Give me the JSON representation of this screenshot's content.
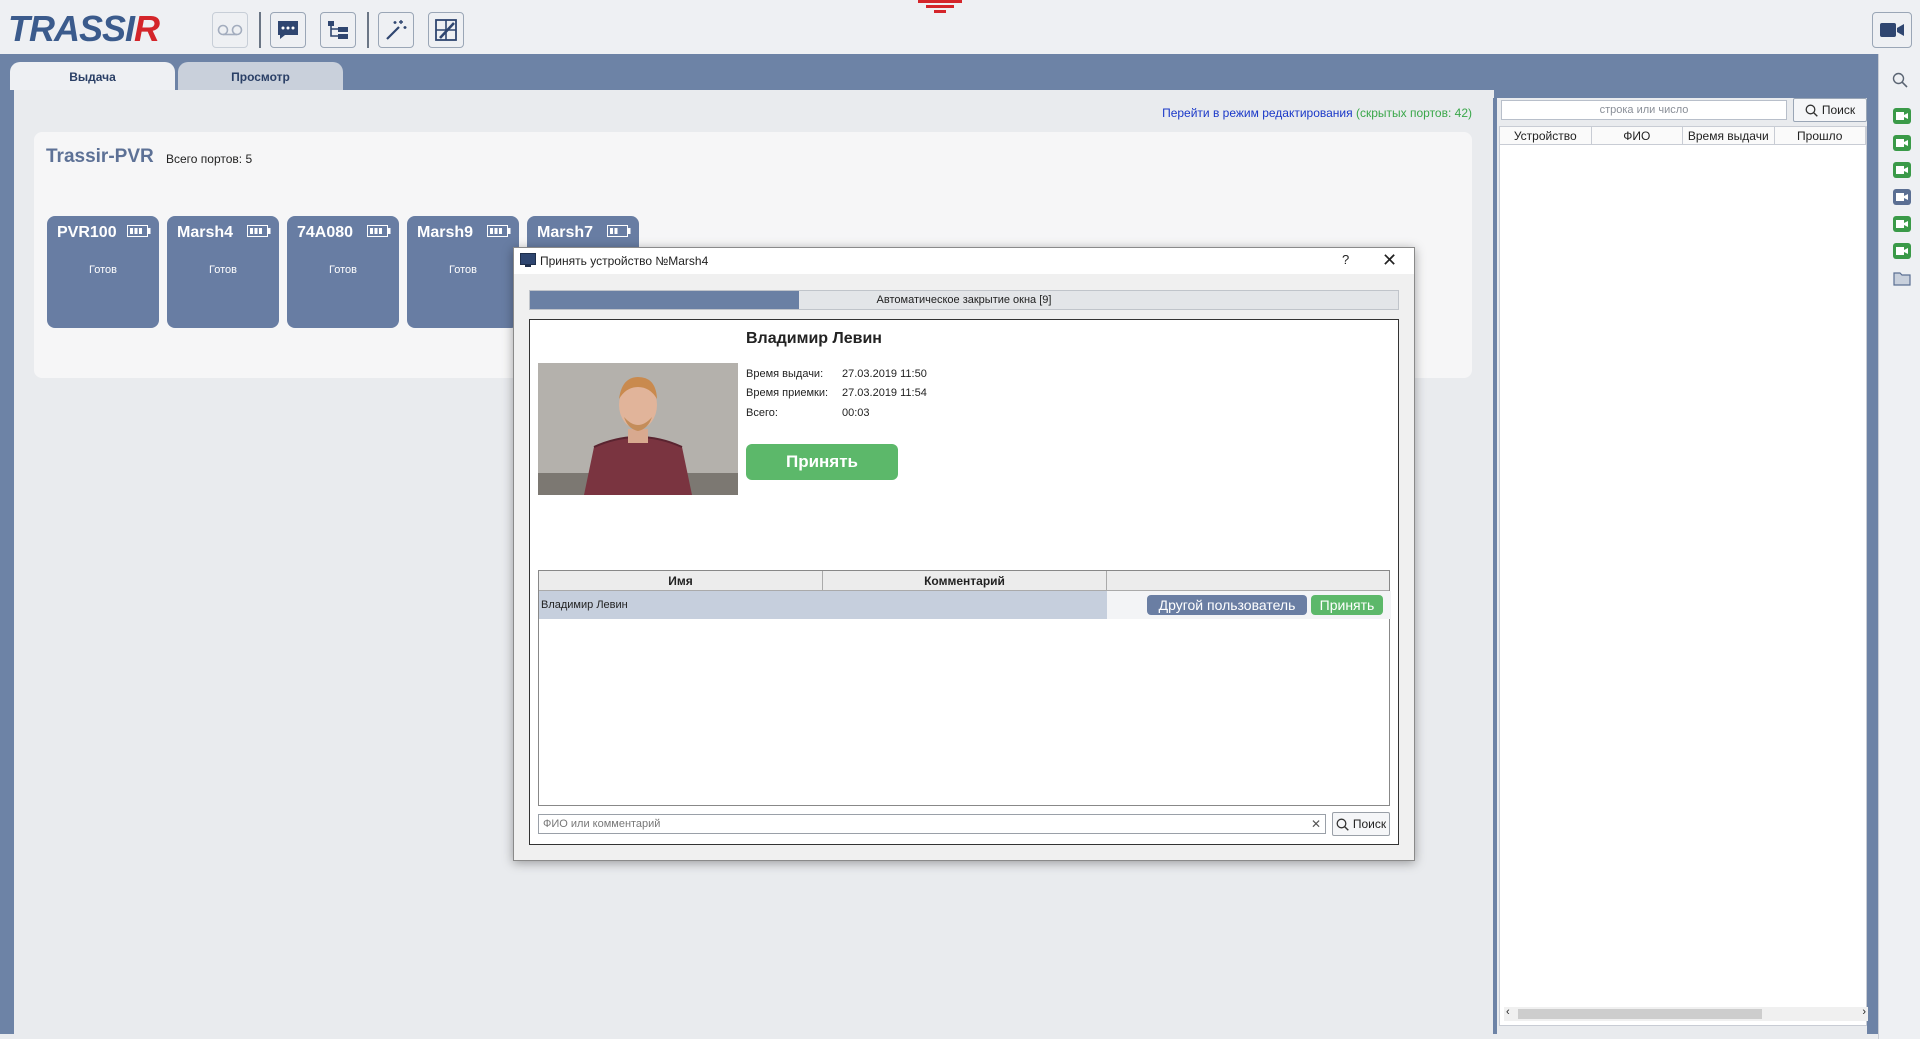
{
  "app": {
    "logo_text": "TRASSIR"
  },
  "tabs": [
    {
      "label": "Выдача"
    },
    {
      "label": "Просмотр"
    }
  ],
  "edit_mode": {
    "link_text": "Перейти в режим редактирования",
    "hidden_ports": "(скрытых портов: 42)"
  },
  "pvr": {
    "title": "Trassir-PVR",
    "total_ports": "Всего портов: 5",
    "ports": [
      {
        "name": "PVR100",
        "status": "Готов"
      },
      {
        "name": "Marsh4",
        "status": "Готов"
      },
      {
        "name": "74A080",
        "status": "Готов"
      },
      {
        "name": "Marsh9",
        "status": "Готов"
      },
      {
        "name": "Marsh7",
        "status": ""
      }
    ]
  },
  "right_panel": {
    "search_placeholder": "строка или число",
    "search_button": "Поиск",
    "columns": [
      "Устройство",
      "ФИО",
      "Время выдачи",
      "Прошло"
    ]
  },
  "dialog": {
    "title": "Принять устройство №Marsh4",
    "help": "?",
    "close": "✕",
    "progress_text": "Автоматическое закрытие окна [9]",
    "progress_fraction": 0.31,
    "user_name": "Владимир Левин",
    "issue_time_label": "Время выдачи:",
    "issue_time_value": "27.03.2019 11:50",
    "accept_time_label": "Время приемки:",
    "accept_time_value": "27.03.2019 11:54",
    "total_label": "Всего:",
    "total_value": "00:03",
    "accept_button": "Принять",
    "table_columns": [
      "Имя",
      "Комментарий",
      ""
    ],
    "row": {
      "name": "Владимир Левин",
      "other_user_button": "Другой пользователь",
      "accept_button": "Принять"
    },
    "search_placeholder": "ФИО или комментарий",
    "search_button": "Поиск"
  },
  "colors": {
    "accent": "#6d83a6",
    "accept_green": "#5cb86a",
    "port_tile": "#687da3",
    "link_blue": "#1a38c8",
    "hidden_green": "#3aa74a"
  }
}
